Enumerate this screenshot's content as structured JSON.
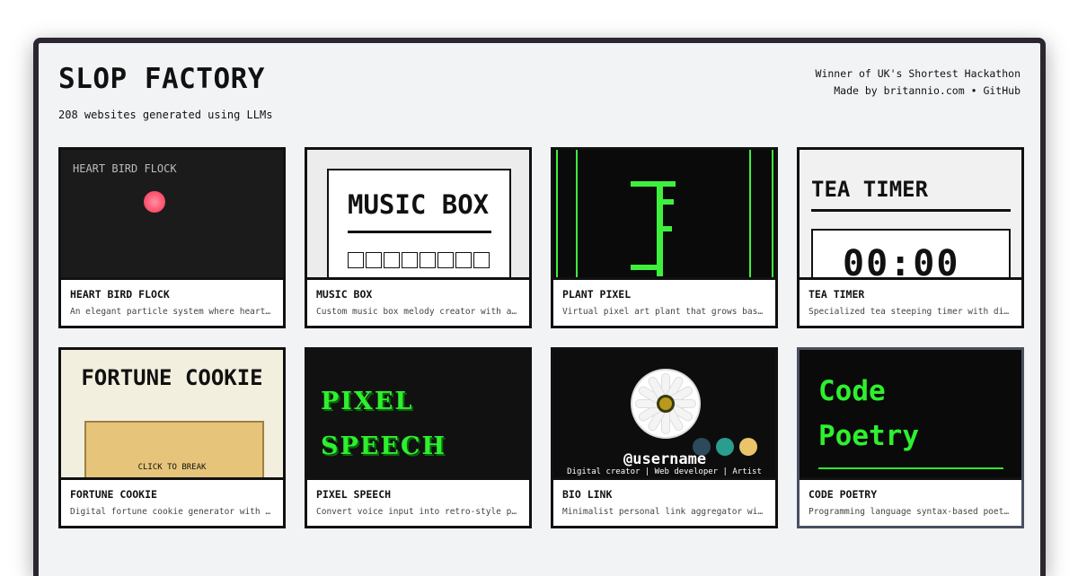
{
  "header": {
    "title": "SLOP FACTORY",
    "subtitle": "208 websites generated using LLMs",
    "right_line1": "Winner of UK's Shortest Hackathon",
    "made_by": "Made by",
    "author_link": "britannio.com",
    "separator": "•",
    "github_link": "GitHub"
  },
  "cards": [
    {
      "title": "HEART BIRD FLOCK",
      "desc": "An elegant particle system where heart-shaped birds flock",
      "thumb_label": "HEART BIRD FLOCK"
    },
    {
      "title": "MUSIC BOX",
      "desc": "Custom music box melody creator with animated playback",
      "thumb_label": "MUSIC BOX"
    },
    {
      "title": "PLANT PIXEL",
      "desc": "Virtual pixel art plant that grows based on care"
    },
    {
      "title": "TEA TIMER",
      "desc": "Specialized tea steeping timer with different presets",
      "thumb_label": "TEA TIMER",
      "thumb_time": "00:00"
    },
    {
      "title": "FORTUNE COOKIE",
      "desc": "Digital fortune cookie generator with paper slips",
      "thumb_label": "FORTUNE COOKIE",
      "thumb_click": "CLICK TO BREAK"
    },
    {
      "title": "PIXEL SPEECH",
      "desc": "Convert voice input into retro-style pixel text",
      "thumb_l1": "PIXEL",
      "thumb_l2": "SPEECH"
    },
    {
      "title": "BIO LINK",
      "desc": "Minimalist personal link aggregator with themes",
      "thumb_user": "@username",
      "thumb_tag": "Digital creator | Web developer | Artist"
    },
    {
      "title": "CODE POETRY",
      "desc": "Programming language syntax-based poetry generator",
      "thumb_l1": "Code",
      "thumb_l2": "Poetry"
    }
  ],
  "colors": {
    "window_border": "#2b2630",
    "terminal_green": "#2ef02e",
    "bio_dot_1": "#2c4a5c",
    "bio_dot_2": "#2a9d8f",
    "bio_dot_3": "#e9c46a"
  }
}
